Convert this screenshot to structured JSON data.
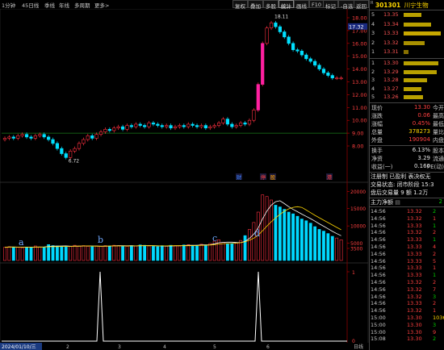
{
  "toolbar": {
    "left_items": [
      "1分钟",
      "45日线",
      "季线",
      "年线",
      "多周期",
      "更多>"
    ],
    "right_buttons": [
      "复权",
      "叠加",
      "多股",
      "统计",
      "画线",
      "F10",
      "标记",
      "-自选",
      "返回"
    ],
    "active_button": "统计"
  },
  "stock": {
    "code_prefix": "R",
    "code": "301301",
    "name": "川宁生物"
  },
  "order_book": {
    "sell": [
      {
        "label": "5",
        "price": "13.35",
        "bar": 0.45
      },
      {
        "label": "4",
        "price": "13.34",
        "bar": 0.7
      },
      {
        "label": "3",
        "price": "13.33",
        "bar": 0.95
      },
      {
        "label": "2",
        "price": "13.32",
        "bar": 0.55
      },
      {
        "label": "1",
        "price": "13.31",
        "bar": 0.12
      }
    ],
    "buy": [
      {
        "label": "1",
        "price": "13.30",
        "bar": 0.9
      },
      {
        "label": "2",
        "price": "13.29",
        "bar": 0.85
      },
      {
        "label": "3",
        "price": "13.28",
        "bar": 0.6
      },
      {
        "label": "4",
        "price": "13.27",
        "bar": 0.45
      },
      {
        "label": "5",
        "price": "13.26",
        "bar": 0.5
      }
    ]
  },
  "stats": {
    "r1": {
      "l": "现价",
      "v": "13.30",
      "r": "今开"
    },
    "r2": {
      "l": "涨跌",
      "v": "0.06",
      "r": "最高"
    },
    "r3": {
      "l": "涨幅",
      "v": "0.45%",
      "r": "最低"
    },
    "r4": {
      "l": "总量",
      "v": "378273",
      "r": "量比"
    },
    "r5": {
      "l": "外盘",
      "v": "190904",
      "r": "内盘"
    },
    "r6": {
      "l": "换手",
      "v": "6.13%",
      "r": "股本"
    },
    "r7": {
      "l": "净资",
      "v": "3.29",
      "r": "流通"
    },
    "r8": {
      "l": "收益(一)",
      "v": "0.160",
      "r": "PE(动)"
    }
  },
  "info_lines": [
    "注册制 已盈利 表决权无",
    "交易状态: 闭市阶段 15:3",
    "盘后交易量 9 额 1.2万"
  ],
  "fund_flow": {
    "label": "主力净额",
    "value": "2"
  },
  "ticks": [
    {
      "t": "14:56",
      "p": "13.32",
      "v": "2",
      "c": "grn"
    },
    {
      "t": "14:56",
      "p": "13.32",
      "v": "1",
      "c": "red"
    },
    {
      "t": "14:56",
      "p": "13.33",
      "v": "1",
      "c": "grn"
    },
    {
      "t": "14:56",
      "p": "13.32",
      "v": "2",
      "c": "red"
    },
    {
      "t": "14:56",
      "p": "13.33",
      "v": "1",
      "c": "grn"
    },
    {
      "t": "14:56",
      "p": "13.33",
      "v": "4",
      "c": "red"
    },
    {
      "t": "14:56",
      "p": "13.33",
      "v": "2",
      "c": "red"
    },
    {
      "t": "14:56",
      "p": "13.33",
      "v": "5",
      "c": "red"
    },
    {
      "t": "14:56",
      "p": "13.33",
      "v": "1",
      "c": "red"
    },
    {
      "t": "14:56",
      "p": "13.33",
      "v": "1",
      "c": "grn"
    },
    {
      "t": "14:56",
      "p": "13.32",
      "v": "2",
      "c": "red"
    },
    {
      "t": "14:56",
      "p": "13.32",
      "v": "7",
      "c": "red"
    },
    {
      "t": "14:56",
      "p": "13.32",
      "v": "3",
      "c": "grn"
    },
    {
      "t": "14:56",
      "p": "13.33",
      "v": "2",
      "c": "red"
    },
    {
      "t": "14:56",
      "p": "13.32",
      "v": "1",
      "c": "red"
    },
    {
      "t": "15:00",
      "p": "13.30",
      "v": "1036",
      "c": "yel"
    },
    {
      "t": "15:00",
      "p": "13.30",
      "v": "3",
      "c": "grn"
    },
    {
      "t": "15:00",
      "p": "13.30",
      "v": "9",
      "c": "red"
    },
    {
      "t": "15:08",
      "p": "13.30",
      "v": "2",
      "c": "grn"
    }
  ],
  "chart_data": {
    "type": "candlestick",
    "price_axis": [
      "18.00",
      "17.00",
      "16.00",
      "15.00",
      "14.00",
      "13.00",
      "12.00",
      "11.00",
      "10.00",
      "9.00",
      "8.00"
    ],
    "current_price_tag": "17.32",
    "high_label": "18.11",
    "low_label": "6.72",
    "volume_axis": [
      "20000",
      "15000",
      "10000",
      "5000",
      "3500"
    ],
    "event_markers": [
      "财",
      "停",
      "股",
      "港"
    ],
    "annotations": [
      "a",
      "b",
      "c",
      "d"
    ],
    "x_ticks": [
      "2024/01/10/三",
      "2",
      "3",
      "4",
      "5",
      "6",
      "日线"
    ],
    "support_price": 9.0,
    "prices": [
      8.6,
      8.7,
      8.6,
      8.8,
      8.9,
      8.7,
      8.6,
      8.8,
      8.9,
      8.7,
      8.5,
      8.2,
      7.8,
      7.4,
      7.1,
      7.6,
      7.8,
      8.2,
      8.5,
      8.8,
      8.6,
      8.9,
      9.1,
      9.3,
      9.2,
      9.4,
      9.5,
      9.3,
      9.6,
      9.5,
      9.7,
      9.6,
      9.5,
      9.8,
      9.7,
      9.6,
      9.5,
      9.6,
      9.4,
      9.5,
      9.6,
      9.5,
      9.7,
      9.6,
      9.5,
      9.6,
      9.4,
      9.5,
      9.6,
      9.8,
      10.1,
      9.7,
      9.5,
      9.6,
      9.8,
      9.7,
      10.0,
      10.8,
      12.8,
      16.0,
      17.2,
      17.6,
      17.3,
      16.9,
      16.5,
      16.0,
      15.5,
      15.4,
      15.1,
      14.8,
      14.6,
      14.3,
      14.0,
      13.7,
      13.5,
      13.3,
      13.3,
      13.3
    ],
    "volumes": [
      3800,
      4000,
      3900,
      3800,
      3700,
      3900,
      3800,
      4200,
      3900,
      3800,
      4600,
      4300,
      4200,
      4100,
      3900,
      4100,
      4400,
      4200,
      4300,
      4100,
      4000,
      4200,
      4100,
      4300,
      4200,
      4400,
      4300,
      4200,
      4100,
      4300,
      4200,
      4500,
      4400,
      4200,
      4100,
      4000,
      4300,
      4200,
      4400,
      4300,
      4200,
      4500,
      4600,
      4300,
      4400,
      4700,
      4500,
      4900,
      5600,
      6000,
      5200,
      4800,
      4900,
      5100,
      5800,
      7200,
      9000,
      11000,
      14000,
      19000,
      18500,
      17500,
      16000,
      15500,
      14800,
      14000,
      13500,
      12800,
      12000,
      11500,
      10800,
      9800,
      9000,
      8500,
      7800,
      7000,
      6500,
      6000
    ]
  },
  "indicator": {
    "peaks": [
      "a",
      "d"
    ],
    "axis": [
      "1",
      "0"
    ]
  }
}
